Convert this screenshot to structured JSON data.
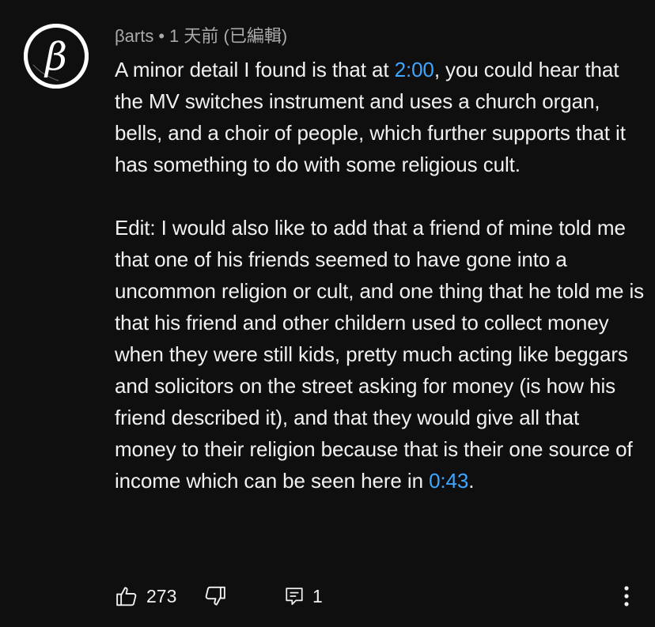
{
  "comment": {
    "author": "βarts",
    "separator": "•",
    "time": "1 天前 (已編輯)",
    "avatar_icon": "beta-letter-avatar",
    "paragraph1": {
      "before": "A minor detail I found is that at ",
      "timestamp": "2:00",
      "after": ", you could hear that the MV switches instrument and uses a church organ, bells, and a choir of people, which further supports that it has something to do with some religious cult."
    },
    "paragraph2": {
      "before": "Edit: I would also like to add that a friend of mine told me that one of his friends seemed to have gone into a uncommon religion or cult, and one thing that he told me is that his friend and other childern used to collect money when they were still kids, pretty much acting like beggars and solicitors on the street asking for money (is how his friend described it), and that they would give all that money to their religion because that is their one source of income which can be seen here in ",
      "timestamp": "0:43",
      "after": "."
    },
    "actions": {
      "like_icon": "thumbs-up-icon",
      "like_count": "273",
      "dislike_icon": "thumbs-down-icon",
      "reply_icon": "reply-comment-icon",
      "reply_count": "1",
      "more_icon": "more-vertical-icon"
    },
    "colors": {
      "background": "#0f0f0f",
      "text": "#f1f1f1",
      "secondary": "#aaaaaa",
      "link": "#3ea6ff"
    }
  }
}
